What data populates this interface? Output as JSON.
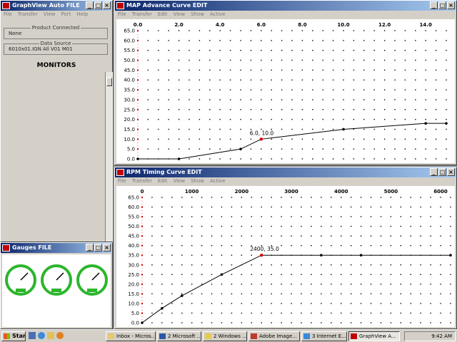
{
  "auto_window": {
    "title": "GraphView Auto FILE",
    "menu": [
      "File",
      "Transfer",
      "View",
      "Port",
      "Help"
    ],
    "product_connected_label": "Product Connected",
    "product_connected_value": "None",
    "data_source_label": "Data Source",
    "data_source_value": "6010x01.IGN All V01 M01",
    "monitors_label": "MONITORS"
  },
  "gauges_window": {
    "title": "Gauges FILE",
    "gauge_count": 3,
    "gauge_color": "#2db52d"
  },
  "map_window": {
    "title": "MAP Advance Curve EDIT",
    "menu": [
      "File",
      "Transfer",
      "Edit",
      "View",
      "Show",
      "Active"
    ],
    "x_ticks": [
      "0.0",
      "2.0",
      "4.0",
      "6.0",
      "8.0",
      "10.0",
      "12.0",
      "14.0"
    ],
    "y_ticks": [
      "65.0",
      "60.0",
      "55.0",
      "50.0",
      "45.0",
      "40.0",
      "35.0",
      "30.0",
      "25.0",
      "20.0",
      "15.0",
      "10.0",
      "5.0",
      "0.0"
    ],
    "point_label": "6.0, 10.0"
  },
  "rpm_window": {
    "title": "RPM Timing Curve EDIT",
    "menu": [
      "File",
      "Transfer",
      "Edit",
      "View",
      "Show",
      "Active"
    ],
    "x_ticks": [
      "0",
      "1000",
      "2000",
      "3000",
      "4000",
      "5000",
      "6000"
    ],
    "y_ticks": [
      "65.0",
      "60.0",
      "55.0",
      "50.0",
      "45.0",
      "40.0",
      "35.0",
      "30.0",
      "25.0",
      "20.0",
      "15.0",
      "10.0",
      "5.0",
      "0.0"
    ],
    "point_label": "2400, 35.0"
  },
  "chart_data": [
    {
      "type": "line",
      "title": "MAP Advance Curve",
      "x": [
        0,
        2,
        5,
        6,
        10,
        14,
        15
      ],
      "y": [
        0,
        0,
        5,
        10,
        15,
        18,
        18
      ],
      "xlim": [
        0,
        15
      ],
      "ylim": [
        0,
        65
      ],
      "x_ticks": [
        0,
        2,
        4,
        6,
        8,
        10,
        12,
        14
      ],
      "y_ticks": [
        0,
        5,
        10,
        15,
        20,
        25,
        30,
        35,
        40,
        45,
        50,
        55,
        60,
        65
      ],
      "highlight": {
        "x": 6,
        "y": 10
      },
      "grid": "dotted"
    },
    {
      "type": "line",
      "title": "RPM Timing Curve",
      "x": [
        0,
        400,
        800,
        1600,
        2400,
        3600,
        4400,
        6200
      ],
      "y": [
        0,
        7.5,
        14,
        25,
        35,
        35,
        35,
        35
      ],
      "xlim": [
        0,
        6200
      ],
      "ylim": [
        0,
        65
      ],
      "x_ticks": [
        0,
        1000,
        2000,
        3000,
        4000,
        5000,
        6000
      ],
      "y_ticks": [
        0,
        5,
        10,
        15,
        20,
        25,
        30,
        35,
        40,
        45,
        50,
        55,
        60,
        65
      ],
      "highlight": {
        "x": 2400,
        "y": 35
      },
      "grid": "dotted"
    }
  ],
  "taskbar": {
    "start_label": "Start",
    "items": [
      "Inbox - Micros...",
      "2 Microsoft ...",
      "2 Windows ...",
      "Adobe Image...",
      "3 Internet E...",
      "GraphView A..."
    ],
    "clock": "9:42 AM"
  }
}
